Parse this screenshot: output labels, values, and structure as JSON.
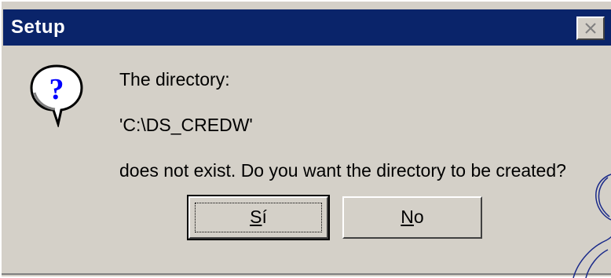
{
  "window": {
    "title": "Setup",
    "close_icon": "close-icon",
    "titlebar_color": "#0a246a",
    "face_color": "#d4d0c8"
  },
  "message": {
    "icon": "question-icon",
    "line1": "The directory:",
    "line2": "'C:\\DS_CREDW'",
    "line3": "does not exist.  Do you want the directory to be created?"
  },
  "buttons": {
    "yes": {
      "label": "Sí",
      "mnemonic": "S",
      "rest": "í"
    },
    "no": {
      "label": "No",
      "mnemonic": "N",
      "rest": "o"
    }
  }
}
